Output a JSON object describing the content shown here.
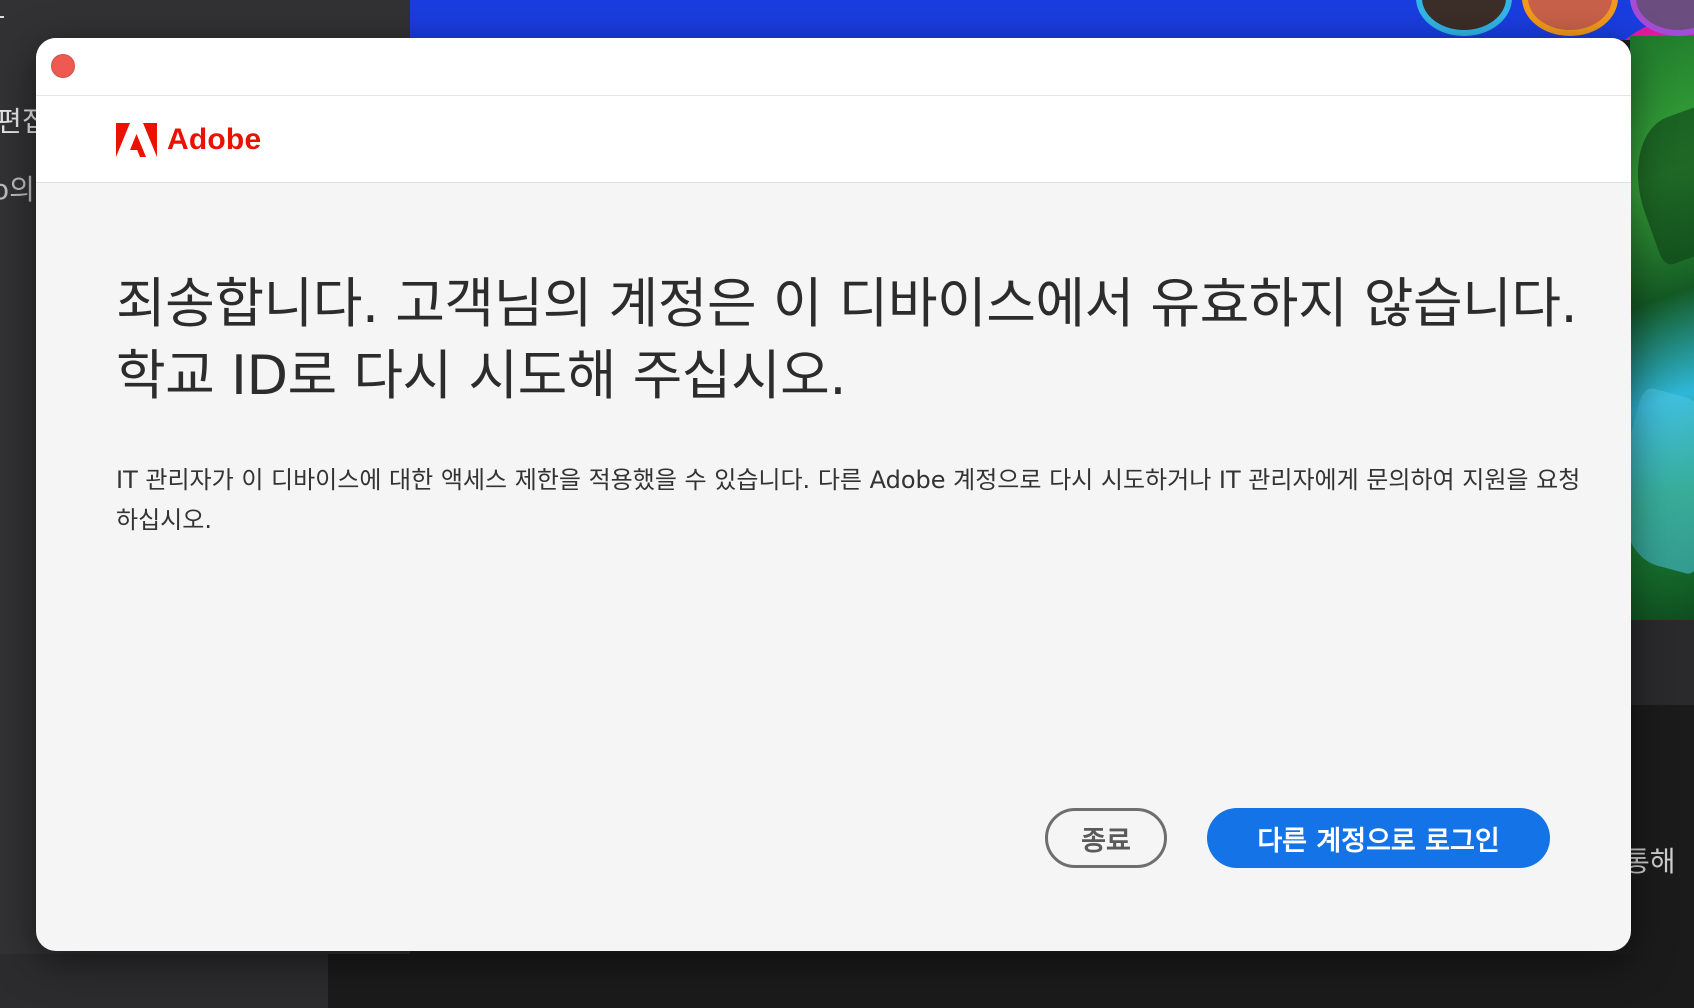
{
  "background": {
    "left_text_1": "편집",
    "left_text_2": "o의",
    "right_text": "통해"
  },
  "dialog": {
    "brand": {
      "name": "Adobe",
      "color": "#eb1000",
      "icon": "adobe-logo-icon"
    },
    "headline": "죄송합니다. 고객님의 계정은 이 디바이스에서 유효하지 않습니다. 학교 ID로 다시 시도해 주십시오.",
    "body": "IT 관리자가 이 디바이스에 대한 액세스 제한을 적용했을 수 있습니다. 다른 Adobe 계정으로 다시 시도하거나 IT 관리자에게 문의하여 지원을 요청하십시오.",
    "buttons": {
      "quit": "종료",
      "login_other": "다른 계정으로 로그인"
    },
    "colors": {
      "primary_button": "#1473e6",
      "close_dot": "#ee5a52"
    }
  }
}
